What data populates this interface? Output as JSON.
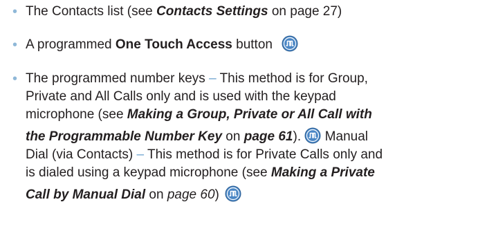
{
  "items": [
    {
      "lines": [
        [
          "The Contacts list (see ",
          "Contacts Settings",
          " on page 27)"
        ]
      ]
    },
    {
      "lines": [
        [
          "A programmed ",
          "One Touch Access",
          " button"
        ]
      ]
    },
    {
      "lines": [
        [
          "The programmed number keys ",
          "–",
          " This method is for Group,"
        ],
        [
          "Private and All Calls only and is used with the keypad"
        ],
        [
          "microphone (see ",
          "Making a Group, Private or All Call with"
        ],
        [
          "the Programmable Number Key",
          " on ",
          "page 61",
          "). ",
          " Manual"
        ],
        [
          "Dial (via Contacts) ",
          "–",
          " This method is for Private Calls only and"
        ],
        [
          "is dialed using a keypad microphone (see ",
          "Making a Private"
        ],
        [
          "Call by Manual Dial",
          " on ",
          "page 60",
          ")"
        ]
      ]
    }
  ],
  "icons": {
    "button_icon": "one-touch-access-button-icon"
  },
  "colors": {
    "bullet": "#8fb8d8",
    "dash": "#6fa4cf",
    "icon_fill": "#4a86c5",
    "text": "#231f20"
  }
}
